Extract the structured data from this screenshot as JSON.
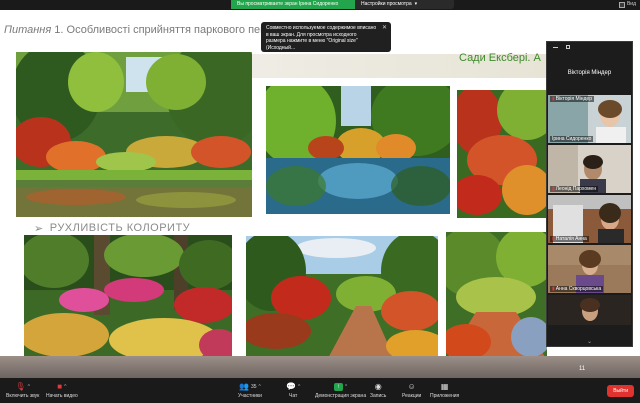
{
  "share_bar": {
    "status": "Вы просматриваете экран Ірина Сидоренко",
    "options": "Настройки просмотра",
    "view": "Вид"
  },
  "tooltip": {
    "text": "Совместно используемое содержимое вписано в ваш экран. Для просмотра исходного размера нажмите в меню \"Original size\" (Исходный..."
  },
  "slide": {
    "title_prefix": "Питання",
    "title_rest": "1. Особливості сприйняття паркового пей",
    "subtitle_right": "Сади Ексбері. А",
    "section_arrow": "➢",
    "section_label": "РУХЛИВІСТЬ КОЛОРИТУ",
    "page_number": "11"
  },
  "panel": {
    "host_name": "Вікторія Міндер",
    "participants": [
      {
        "name": "Вікторія Міндер",
        "muted": true,
        "label_position": "top"
      },
      {
        "name": "Ірина Сидоренко",
        "muted": false,
        "label_position": "bottom"
      },
      {
        "name": "Леонід Пархомен",
        "muted": true,
        "label_position": "bottom"
      },
      {
        "name": "Наталія Анна",
        "muted": true,
        "label_position": "bottom"
      },
      {
        "name": "Анна Скворцовська",
        "muted": true,
        "label_position": "bottom"
      },
      {
        "name": "",
        "muted": false,
        "label_position": "none"
      }
    ]
  },
  "toolbar": {
    "audio": "Включить звук",
    "video": "Начать видео",
    "participants": "Участники",
    "participants_count": "35",
    "chat": "Чат",
    "share": "Демонстрация экрана",
    "record": "Запись",
    "reactions": "Реакции",
    "apps": "Приложения",
    "end": "Выйти"
  },
  "colors": {
    "share_green": "#22a54c",
    "end_red": "#e0332f",
    "toolbar_bg": "#1a1a1a"
  }
}
